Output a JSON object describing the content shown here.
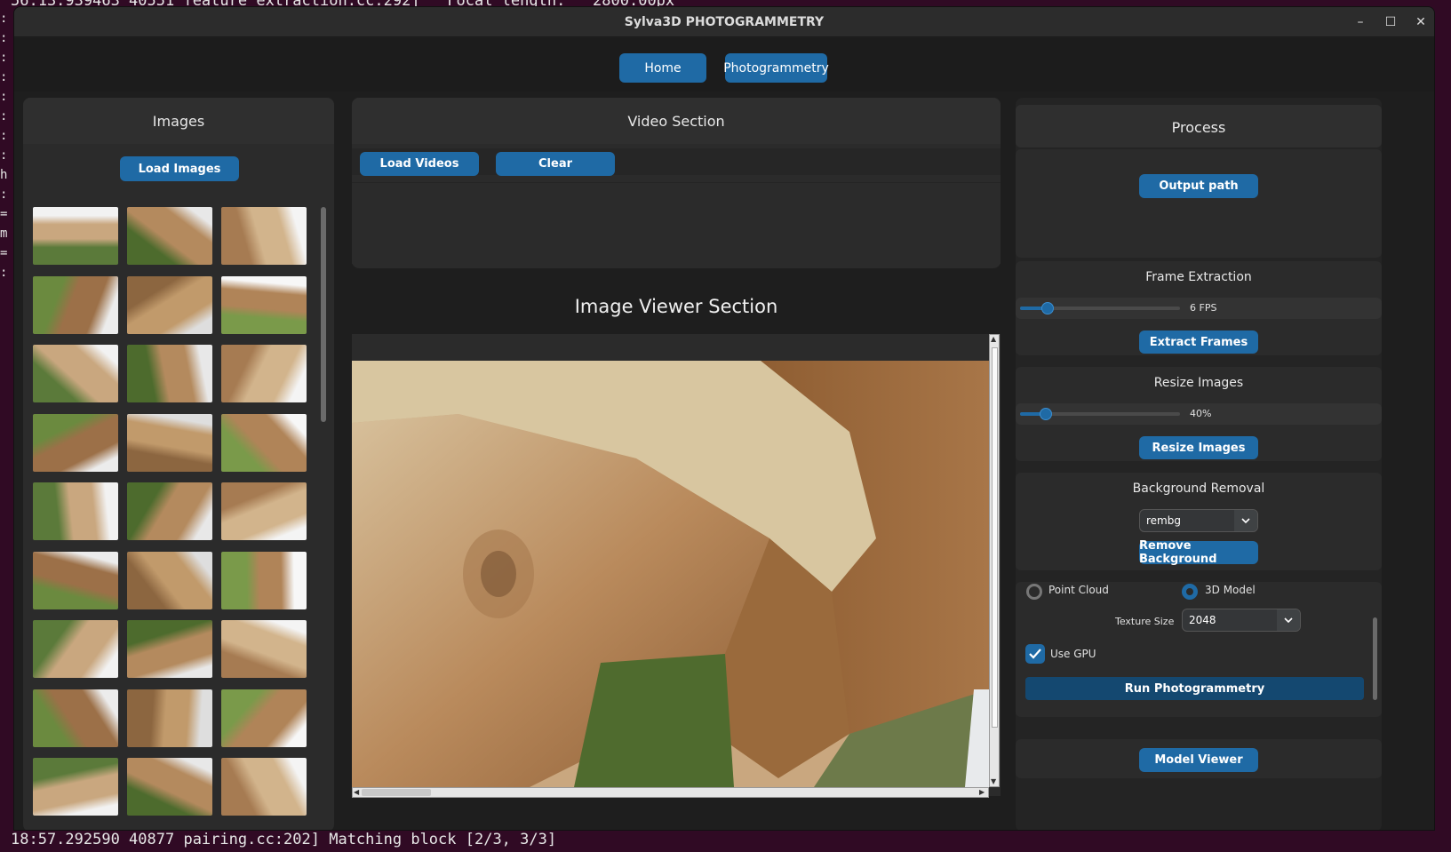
{
  "terminal": {
    "top_line": "56:13.939463 40551 feature_extraction.cc:292]   Focal length:   2800.00px",
    "bottom_line": "18:57.292590 40877 pairing.cc:202] Matching block [2/3, 3/3]",
    "gutter": ":\n:\n:\n:\n:\n:\n:\n:\nh\n:\n=\nm\n=\n:"
  },
  "window": {
    "title": "Sylva3D PHOTOGRAMMETRY",
    "controls": {
      "minimize": "–",
      "maximize": "☐",
      "close": "✕"
    }
  },
  "nav": {
    "home": "Home",
    "photogrammetry": "Photogrammetry"
  },
  "images_panel": {
    "title": "Images",
    "load_button": "Load Images",
    "thumbnail_count": 27
  },
  "video_section": {
    "title": "Video Section",
    "load_videos": "Load Videos",
    "clear": "Clear"
  },
  "image_viewer": {
    "title": "Image Viewer Section"
  },
  "process": {
    "title": "Process",
    "output_path": "Output path",
    "frame_extraction": {
      "title": "Frame Extraction",
      "fps_label": "6 FPS",
      "fps_fraction": 0.17,
      "button": "Extract Frames"
    },
    "resize_images": {
      "title": "Resize Images",
      "value_label": "40%",
      "fraction": 0.16,
      "button": "Resize Images"
    },
    "background_removal": {
      "title": "Background Removal",
      "method": "rembg",
      "button": "Remove Background"
    },
    "photogrammetry": {
      "option_point_cloud": "Point Cloud",
      "option_3d_model": "3D Model",
      "selected": "3D Model",
      "texture_size_label": "Texture Size",
      "texture_size": "2048",
      "use_gpu_label": "Use GPU",
      "use_gpu": true,
      "run_button": "Run Photogrammetry"
    },
    "model_viewer": "Model Viewer"
  },
  "colors": {
    "accent": "#1f6aa5",
    "panel": "#2b2b2b",
    "background": "#1e1e1e"
  }
}
